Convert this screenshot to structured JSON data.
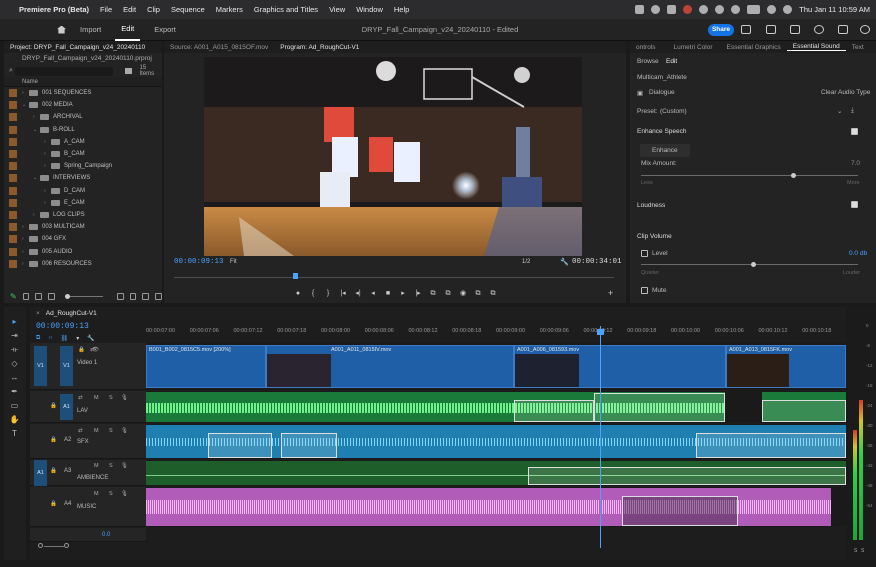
{
  "menubar": {
    "apple": "",
    "app": "Premiere Pro (Beta)",
    "items": [
      "File",
      "Edit",
      "Clip",
      "Sequence",
      "Markers",
      "Graphics and Titles",
      "View",
      "Window",
      "Help"
    ],
    "datetime": "Thu Jan 11  10:59 AM"
  },
  "header": {
    "workspaces": [
      "Import",
      "Edit",
      "Export"
    ],
    "active_workspace": "Edit",
    "title": "DRYP_Fall_Campaign_v24_20240110 - Edited",
    "share_label": "Share"
  },
  "project": {
    "tab": "Project: DRYP_Fall_Campaign_v24_20240110",
    "file": "DRYP_Fall_Campaign_v24_20240110.prproj",
    "count": "15 Items",
    "column": "Name",
    "bins": [
      {
        "label": "001 SEQUENCES",
        "indent": 0,
        "twirl": "›"
      },
      {
        "label": "002 MEDIA",
        "indent": 0,
        "twirl": "⌄"
      },
      {
        "label": "ARCHIVAL",
        "indent": 1,
        "twirl": "›"
      },
      {
        "label": "B-ROLL",
        "indent": 1,
        "twirl": "⌄"
      },
      {
        "label": "A_CAM",
        "indent": 2,
        "twirl": "›"
      },
      {
        "label": "B_CAM",
        "indent": 2,
        "twirl": "›"
      },
      {
        "label": "Spring_Campaign",
        "indent": 2,
        "twirl": "›"
      },
      {
        "label": "INTERVIEWS",
        "indent": 1,
        "twirl": "⌄"
      },
      {
        "label": "D_CAM",
        "indent": 2,
        "twirl": "›"
      },
      {
        "label": "E_CAM",
        "indent": 2,
        "twirl": "›"
      },
      {
        "label": "LOG CLIPS",
        "indent": 1,
        "twirl": "›"
      },
      {
        "label": "003 MULTICAM",
        "indent": 0,
        "twirl": "›"
      },
      {
        "label": "004 GFX",
        "indent": 0,
        "twirl": "›"
      },
      {
        "label": "005 AUDIO",
        "indent": 0,
        "twirl": "›"
      },
      {
        "label": "006 RESOURCES",
        "indent": 0,
        "twirl": "›"
      }
    ]
  },
  "monitor": {
    "source_tab": "Source: A001_A015_0815OF.mov",
    "program_tab": "Program: Ad_RoughCut-V1",
    "timecode": "00:00:09:13",
    "fit": "Fit",
    "resolution": "1/2",
    "duration": "00:00:34:01",
    "transport": [
      "●",
      "{",
      "}",
      "|◂",
      "◂|",
      "◂",
      "■",
      "▸",
      "|▸",
      "⧉",
      "⧉",
      "◉",
      "⧉",
      "⧉"
    ]
  },
  "esound": {
    "tabs": [
      "ontrols",
      "Lumetri Color",
      "Essential Graphics",
      "Essential Sound",
      "Text"
    ],
    "active_tab": "Essential Sound",
    "subtabs": [
      "Browse",
      "Edit"
    ],
    "active_subtab": "Edit",
    "clip_name": "Multicam_Athlete",
    "type": "Dialogue",
    "clear": "Clear Audio Type",
    "preset_label": "Preset:",
    "preset_value": "(Custom)",
    "enhance_speech": "Enhance Speech",
    "enhance_btn": "Enhance",
    "mix_amount": "Mix Amount:",
    "mix_value": "7.0",
    "mix_level": 0.7,
    "less": "Less",
    "more": "More",
    "loudness": "Loudness",
    "clip_volume": "Clip Volume",
    "level": "Level",
    "level_value": "0.0 db",
    "quieter": "Quieter",
    "louder": "Louder",
    "mute": "Mute"
  },
  "timeline": {
    "tab": "Ad_RoughCut-V1",
    "timecode": "00:00:09:13",
    "ruler": [
      "00:00:07:00",
      "00:00:07:06",
      "00:00:07:12",
      "00:00:07:18",
      "00:00:08:00",
      "00:00:08:06",
      "00:00:08:12",
      "00:00:08:18",
      "00:00:09:00",
      "00:00:09:06",
      "00:00:09:12",
      "00:00:09:18",
      "00:00:10:00",
      "00:00:10:06",
      "00:00:10:12",
      "00:00:10:18"
    ],
    "tracks": [
      {
        "id": "V1",
        "name": "Video 1"
      },
      {
        "id": "A1",
        "name": "LAV"
      },
      {
        "id": "A2",
        "name": "SFX"
      },
      {
        "id": "A3",
        "name": "AMBIENCE"
      },
      {
        "id": "A4",
        "name": "MUSIC"
      }
    ],
    "video_clips": [
      "B001_B002_0815C5.mov [200%]",
      "A001_A011_0815IV.mov",
      "A001_A006_081593.mov",
      "A001_A013_0815FK.mov"
    ],
    "master_value": "0.0",
    "colors": {
      "video": "#1f5fa7",
      "lav": "#1a7a3a",
      "sfx": "#1e7fb0",
      "music": "#b05cb8",
      "playhead": "#4aa3ff"
    }
  },
  "meters": {
    "scale": [
      "0",
      "-6",
      "-12",
      "-18",
      "-24",
      "-30",
      "-36",
      "-42",
      "-48",
      "-54"
    ],
    "levels": [
      0.55,
      0.7
    ]
  }
}
